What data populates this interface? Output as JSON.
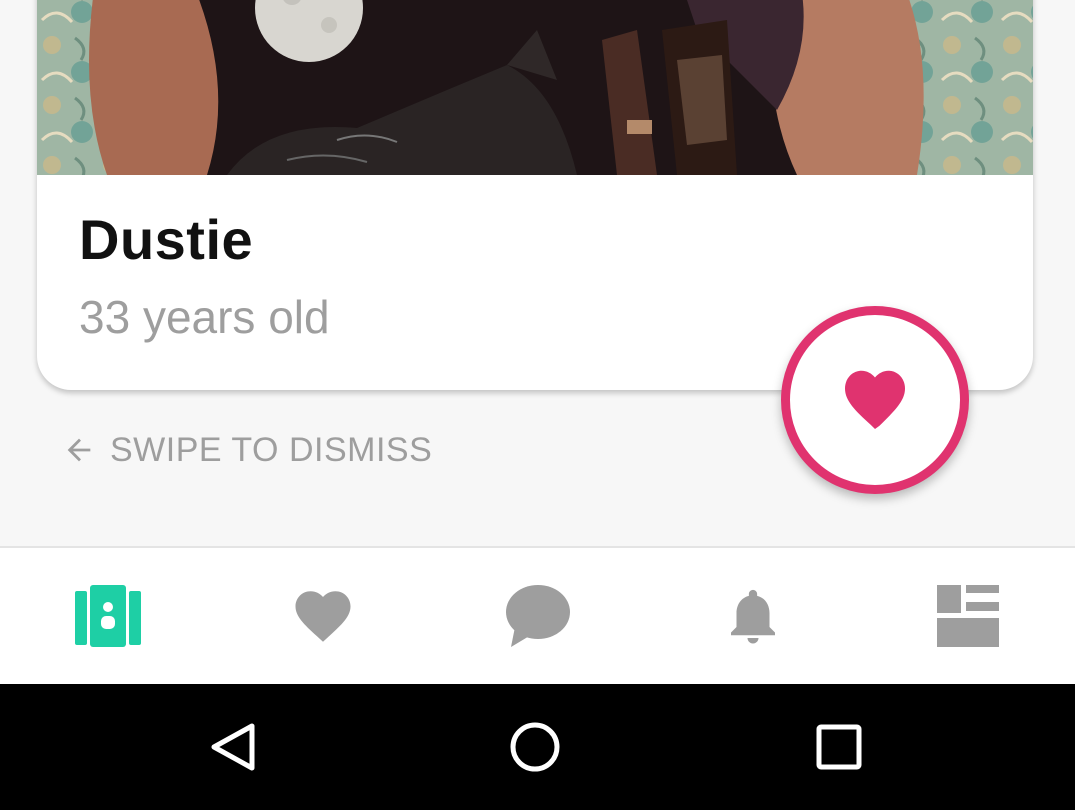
{
  "profile": {
    "name": "Dustie",
    "age_text": "33 years old"
  },
  "swipe_hint": {
    "label": "SWIPE TO DISMISS",
    "icon": "arrow-left-icon"
  },
  "like_button": {
    "icon": "heart-icon",
    "color": "#e0336f"
  },
  "bottom_nav": {
    "active_color": "#1ecfa5",
    "inactive_color": "#9e9e9e",
    "items": [
      {
        "icon": "cards-icon",
        "active": true
      },
      {
        "icon": "heart-icon",
        "active": false
      },
      {
        "icon": "chat-bubble-icon",
        "active": false
      },
      {
        "icon": "bell-icon",
        "active": false
      },
      {
        "icon": "dashboard-icon",
        "active": false
      }
    ]
  },
  "system_nav": {
    "items": [
      "back-triangle-icon",
      "home-circle-icon",
      "recents-square-icon"
    ]
  }
}
